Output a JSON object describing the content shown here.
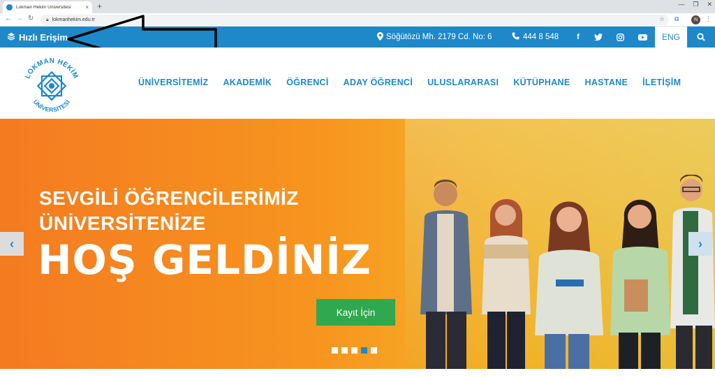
{
  "browser": {
    "tab_title": "Lokman Hekim Üniversitesi",
    "tab_close": "×",
    "new_tab": "+",
    "url": "lokmanhekim.edu.tr",
    "profile_initial": "N",
    "window_controls": [
      "—",
      "❐",
      "✕"
    ]
  },
  "topbar": {
    "quick_access": "Hızlı Erişim",
    "address": "Söğütözü Mh. 2179 Cd. No: 6",
    "phone": "444 8 548",
    "social": [
      "facebook",
      "twitter",
      "instagram",
      "youtube"
    ],
    "lang": "ENG",
    "color": "#1e88c9"
  },
  "logo": {
    "text_top": "LOKMAN HEKİM",
    "text_bottom": "ÜNİVERSİTESİ"
  },
  "nav": [
    {
      "label": "ÜNİVERSİTEMİZ"
    },
    {
      "label": "AKADEMİK"
    },
    {
      "label": "ÖĞRENCİ"
    },
    {
      "label": "ADAY ÖĞRENCİ"
    },
    {
      "label": "ULUSLARARASI"
    },
    {
      "label": "KÜTÜPHANE"
    },
    {
      "label": "HASTANE"
    },
    {
      "label": "İLETİŞİM"
    }
  ],
  "hero": {
    "line1": "SEVGİLİ ÖĞRENCİLERİMİZ",
    "line2": "ÜNİVERSİTENİZE",
    "headline": "HOŞ GELDİNİZ",
    "cta": "Kayıt İçin",
    "active_slide": 4,
    "slide_count": 5
  },
  "icons": {
    "quick_access": "layers-icon",
    "address": "map-marker-icon",
    "phone": "phone-icon",
    "search": "search-icon",
    "prev": "chevron-left-icon",
    "next": "chevron-right-icon"
  }
}
